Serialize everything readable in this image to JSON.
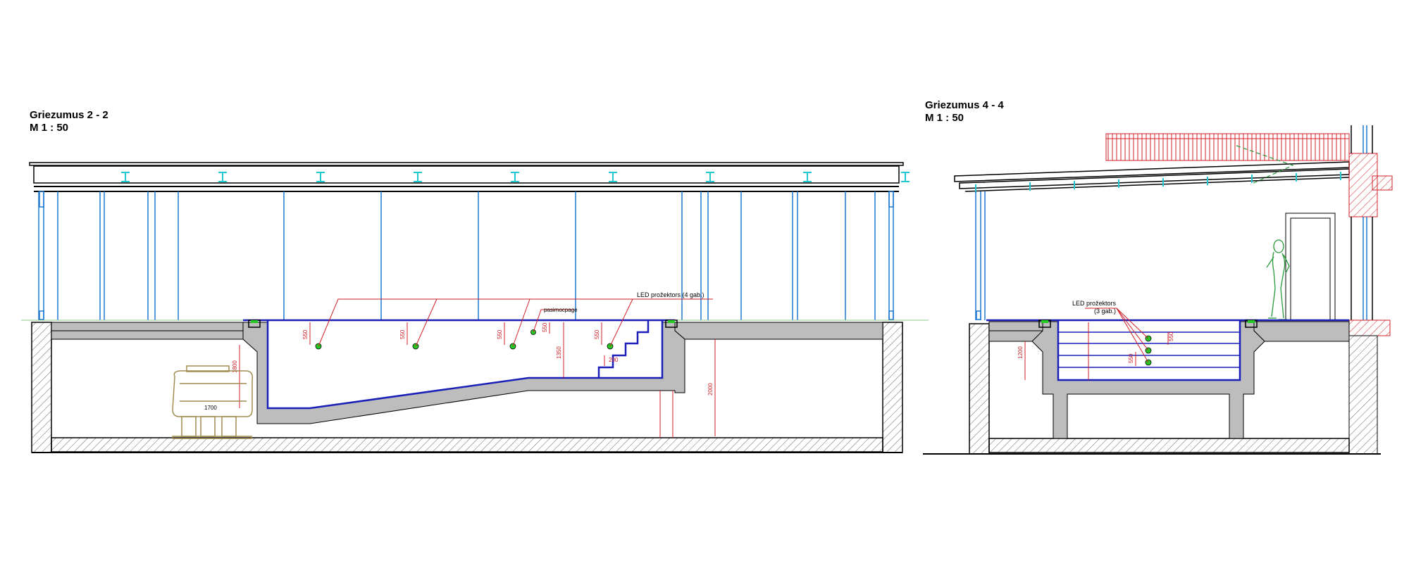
{
  "section_left": {
    "title": "Griezumus 2 - 2",
    "scale": "M 1 : 50",
    "labels": {
      "led_projectors": "LED prožektors (4 gab.)",
      "pasimocpage": "pasimocpage",
      "tank_width": "1700"
    },
    "dimensions": [
      "550",
      "550",
      "550",
      "550",
      "1350",
      "1800",
      "2000",
      "550",
      "200"
    ]
  },
  "section_right": {
    "title": "Griezumus 4 - 4",
    "scale": "M 1 : 50",
    "labels": {
      "led_projectors_line1": "LED prožektors",
      "led_projectors_line2": "(3 gab.)"
    },
    "dimensions": [
      "1200",
      "550",
      "550"
    ]
  },
  "colors": {
    "structure": "#000000",
    "concrete": "#bdbdbd",
    "glazing": "#1e78d2",
    "pool_outline": "#1a1fb8",
    "dimension": "#d0202a",
    "light": "#22cc22",
    "beam": "#22c8d0",
    "person": "#2a9a3a",
    "tank": "#a08c50"
  }
}
